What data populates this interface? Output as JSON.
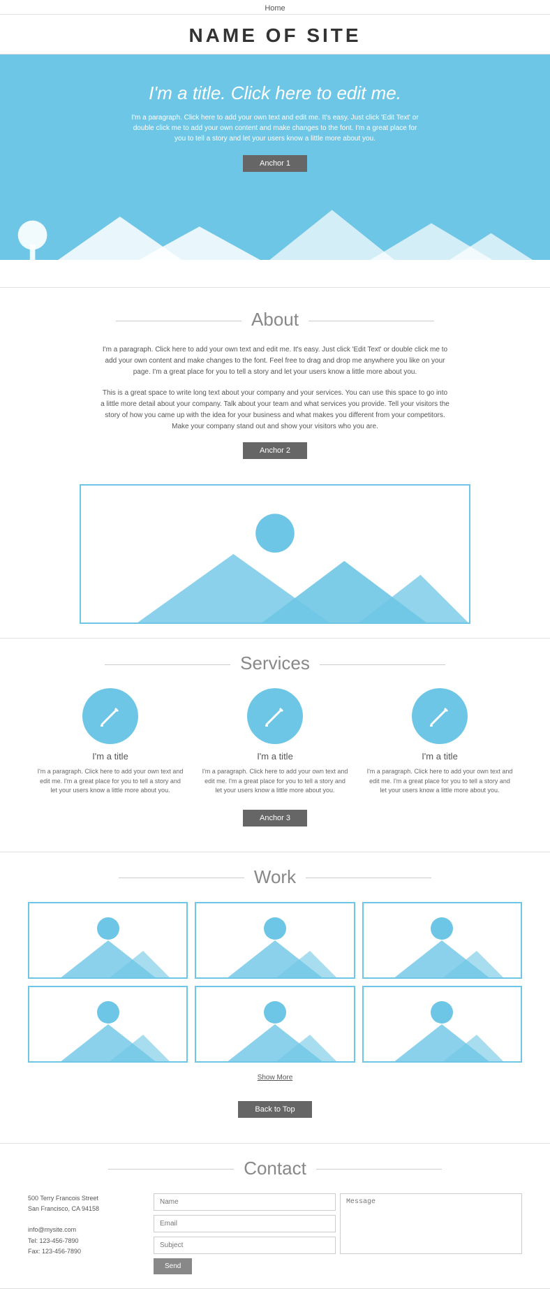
{
  "nav": {
    "home": "Home"
  },
  "header": {
    "site_title": "NAME OF SITE"
  },
  "hero": {
    "title": "I'm a title. Click here to edit me.",
    "paragraph": "I'm a paragraph. Click here to add your own text and edit me. It's easy. Just click 'Edit Text' or double click me to add your own content and make changes to the font. I'm a great place for you to tell a story and let your users know a little more about you.",
    "anchor_label": "Anchor 1"
  },
  "about": {
    "section_title": "About",
    "para1": "I'm a paragraph. Click here to add your own text and edit me. It's easy. Just click 'Edit Text' or double click me to add your own content and make changes to the font. Feel free to drag and drop me anywhere you like on your page. I'm a great place for you to tell a story and let your users know a little more about you.",
    "para2": "This is a great space to write long text about your company and your services. You can use this space to go into a little more detail about your company. Talk about your team and what services you provide. Tell your visitors the story of how you came up with the idea for your business and what makes you different from your competitors. Make your company stand out and show your visitors who you are.",
    "anchor_label": "Anchor 2"
  },
  "services": {
    "section_title": "Services",
    "items": [
      {
        "title": "I'm a title",
        "paragraph": "I'm a paragraph. Click here to add your own text and edit me. I'm a great place for you to tell a story and let your users know a little more about you."
      },
      {
        "title": "I'm a title",
        "paragraph": "I'm a paragraph. Click here to add your own text and edit me. I'm a great place for you to tell a story and let your users know a little more about you."
      },
      {
        "title": "I'm a title",
        "paragraph": "I'm a paragraph. Click here to add your own text and edit me. I'm a great place for you to tell a story and let your users know a little more about you."
      }
    ],
    "anchor_label": "Anchor 3"
  },
  "work": {
    "section_title": "Work",
    "show_more": "Show More",
    "back_to_top": "Back to Top",
    "thumbs_count": 6
  },
  "contact": {
    "section_title": "Contact",
    "address_line1": "500 Terry Francois Street",
    "address_line2": "San Francisco, CA 94158",
    "email": "info@mysite.com",
    "tel": "Tel: 123-456-7890",
    "fax": "Fax: 123-456-7890",
    "form": {
      "name_placeholder": "Name",
      "email_placeholder": "Email",
      "subject_placeholder": "Subject",
      "message_placeholder": "Message",
      "submit_label": "Send"
    }
  }
}
